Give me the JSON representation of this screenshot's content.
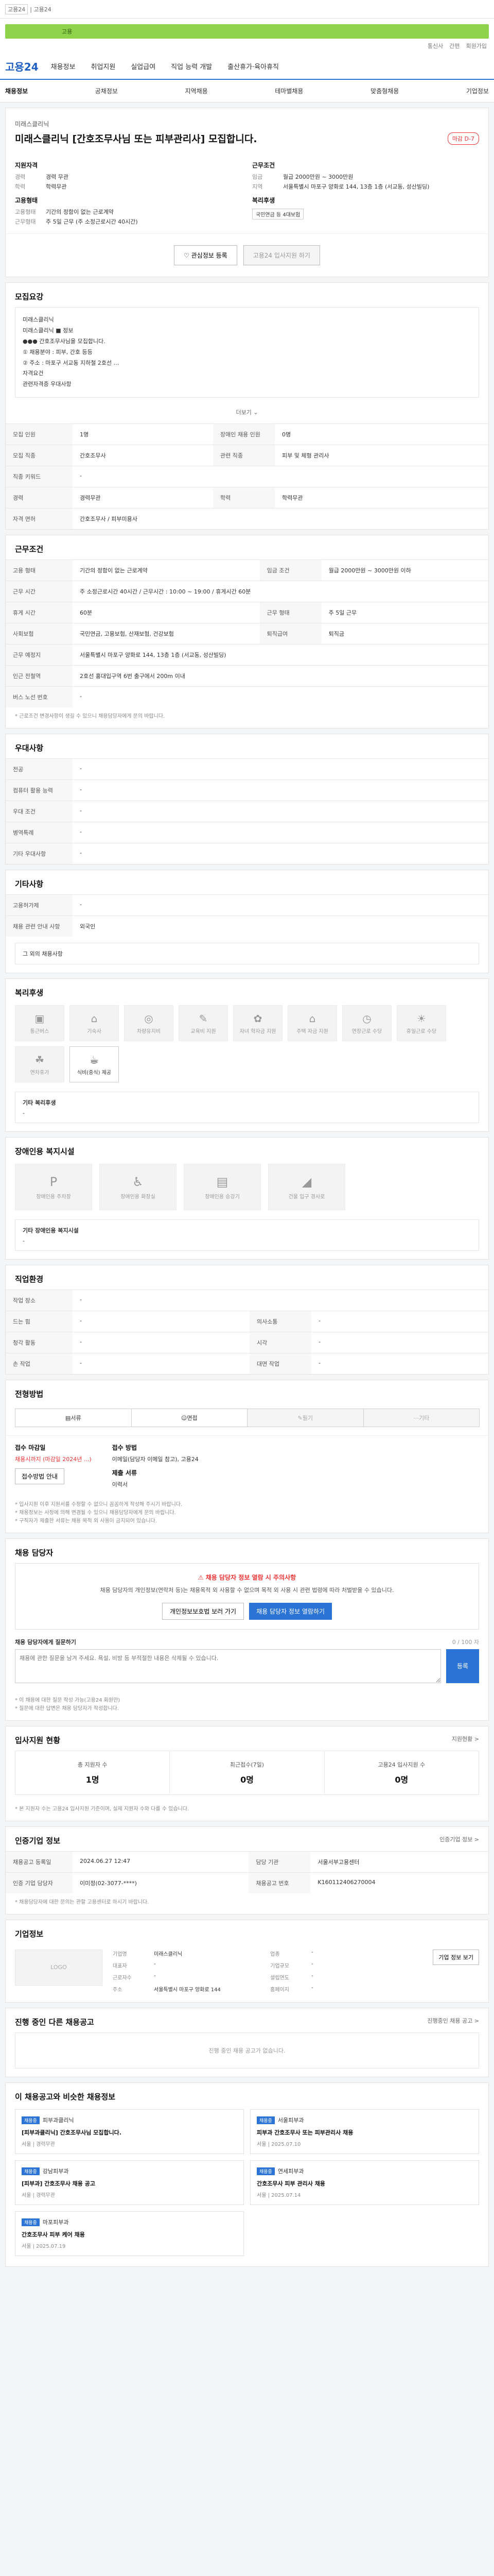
{
  "topbar": {
    "badge": "고용24",
    "text": "| 고용24"
  },
  "banner": {
    "text": "고용",
    "links": [
      "통신사",
      "간편",
      "회원가입"
    ]
  },
  "nav": {
    "logo": "고용24",
    "items": [
      "채용정보",
      "취업지원",
      "실업급여",
      "직업 능력 개발",
      "출산휴가·육아휴직"
    ]
  },
  "subnav": {
    "items": [
      "채용정보",
      "공채정보",
      "지역채용",
      "테마별채용",
      "맞춤형채용",
      "기업정보"
    ]
  },
  "company": {
    "name": "미래스클리닉",
    "title": "미래스클리닉 [간호조무사님 또는 피부관리사] 모집합니다.",
    "tag": "마감 D-7",
    "left_title": "지원자격",
    "left": [
      {
        "k": "경력",
        "v": "경력 무관"
      },
      {
        "k": "학력",
        "v": "학력무관"
      }
    ],
    "left_title2": "고용형태",
    "left2": [
      {
        "k": "고용형태",
        "v": "기간의 정함이 없는 근로계약"
      },
      {
        "k": "근무형태",
        "v": "주 5일 근무 (주 소정근로시간 40시간)"
      }
    ],
    "right_title": "근무조건",
    "right": [
      {
        "k": "임금",
        "v": "월급 2000만원 ~ 3000만원"
      },
      {
        "k": "지역",
        "v": "서울특별시 마포구 양화로 144, 13층 1층 (서교동, 성산빌딩)"
      }
    ],
    "right_title2": "복리후생",
    "right2_chip": "국민연금 등 4대보험"
  },
  "actions": {
    "scrap": "관심정보 등록",
    "apply": "고용24 입사지원 하기"
  },
  "recruit": {
    "title": "모집요강",
    "detail_lines": [
      "미래스클리닉",
      "미래스클리닉 ■ 정보",
      "●●● 간호조무사님을 모집합니다.",
      "① 채용분야 : 피부, 간호 등등",
      "② 주소 : 마포구 서교동 지하철 2호선 ...",
      "자격요건",
      "관련자격증 우대사항"
    ],
    "more": "더보기",
    "rows": [
      {
        "k": "모집 인원",
        "v": "1명",
        "k2": "장애인 채용 인원",
        "v2": "0명"
      },
      {
        "k": "모집 직종",
        "v": "간호조무사",
        "k2": "관련 직종",
        "v2": "피부 및 체형 관리사"
      },
      {
        "k": "직종 키워드",
        "v": "-",
        "k2": "",
        "v2": ""
      },
      {
        "k": "경력",
        "v": "경력무관",
        "k2": "학력",
        "v2": "학력무관"
      },
      {
        "k": "자격 면허",
        "v": "간호조무사 / 피부미용사",
        "k2": "",
        "v2": ""
      }
    ]
  },
  "conditions": {
    "title": "근무조건",
    "rows": [
      {
        "k": "고용 형태",
        "v": "기간의 정함이 없는 근로계약",
        "k2": "임금 조건",
        "v2": "월급 2000만원 ~ 3000만원 이하"
      },
      {
        "k": "근무 시간",
        "v": "주 소정근로시간 40시간 / 근무시간 : 10:00 ~ 19:00 / 휴게시간 60분",
        "k2": "",
        "v2": ""
      },
      {
        "k": "휴게 시간",
        "v": "60분",
        "k2": "근무 형태",
        "v2": "주 5일 근무"
      },
      {
        "k": "사회보험",
        "v": "국민연금, 고용보험, 산재보험, 건강보험",
        "k2": "퇴직급여",
        "v2": "퇴직금"
      },
      {
        "k": "근무 예정지",
        "v": "서울특별시 마포구 양화로 144, 13층 1층 (서교동, 성산빌딩)",
        "k2": "",
        "v2": ""
      },
      {
        "k": "인근 전철역",
        "v": "2호선 홍대입구역 6번 출구에서 200m 이내",
        "k2": "",
        "v2": ""
      },
      {
        "k": "버스 노선 번호",
        "v": "-",
        "k2": "",
        "v2": ""
      }
    ],
    "note": "* 근로조건 변경사항이 생길 수 있으니 채용담당자에게 문의 바랍니다."
  },
  "preferences": {
    "title": "우대사항",
    "rows": [
      {
        "k": "전공",
        "v": "-"
      },
      {
        "k": "컴퓨터 활용 능력",
        "v": "-"
      },
      {
        "k": "우대 조건",
        "v": "-"
      },
      {
        "k": "병역특례",
        "v": "-"
      },
      {
        "k": "기타 우대사항",
        "v": "-"
      }
    ]
  },
  "other": {
    "title": "기타사항",
    "rows": [
      {
        "k": "고용허가제",
        "v": "-"
      },
      {
        "k": "채용 관련 안내 사항",
        "v": "외국인"
      }
    ],
    "sub": "그 외의 채용사항"
  },
  "welfare": {
    "title": "복리후생",
    "items": [
      {
        "label": "통근버스",
        "glyph": "▣",
        "on": false
      },
      {
        "label": "기숙사",
        "glyph": "⌂",
        "on": false
      },
      {
        "label": "차량유지비",
        "glyph": "◎",
        "on": false
      },
      {
        "label": "교육비 지원",
        "glyph": "✎",
        "on": false
      },
      {
        "label": "자녀 학자금 지원",
        "glyph": "✿",
        "on": false
      },
      {
        "label": "주택 자금 지원",
        "glyph": "⌂",
        "on": false
      },
      {
        "label": "연장근로 수당",
        "glyph": "◷",
        "on": false
      },
      {
        "label": "휴일근로 수당",
        "glyph": "☀",
        "on": false
      },
      {
        "label": "연차휴가",
        "glyph": "☘",
        "on": false
      },
      {
        "label": "식비(중식) 제공",
        "glyph": "☕",
        "on": true
      }
    ],
    "sub_title": "기타 복리후생",
    "sub_value": "-"
  },
  "access": {
    "title": "장애인용 복지시설",
    "items": [
      {
        "label": "장애인용 주차장",
        "glyph": "P"
      },
      {
        "label": "장애인용 화장실",
        "glyph": "♿"
      },
      {
        "label": "장애인용 승강기",
        "glyph": "▤"
      },
      {
        "label": "건물 입구 경사로",
        "glyph": "◢"
      }
    ],
    "sub_title": "기타 장애인용 복지시설",
    "sub_value": "-"
  },
  "career": {
    "title": "직업환경",
    "rows": [
      {
        "k": "작업 장소",
        "v": "-",
        "k2": "",
        "v2": ""
      },
      {
        "k": "드는 힘",
        "v": "-",
        "k2": "의사소통",
        "v2": "-"
      },
      {
        "k": "청각 활동",
        "v": "-",
        "k2": "시각",
        "v2": "-"
      },
      {
        "k": "손 작업",
        "v": "-",
        "k2": "대면 작업",
        "v2": "-"
      }
    ]
  },
  "process": {
    "title": "전형방법",
    "steps": [
      {
        "label": "서류",
        "on": true
      },
      {
        "label": "면접",
        "on": true
      },
      {
        "label": "필기",
        "on": false
      },
      {
        "label": "기타",
        "on": false
      }
    ],
    "apply_title": "접수 마감일",
    "apply_value": "채용시까지 (마감일 2024년 ...)",
    "apply_link": "접수방법",
    "method_title": "접수 방법",
    "method_value": "이메일(담당자 이메일 참고), 고용24",
    "doc_title": "제출 서류",
    "doc_value": "이력서",
    "apply_btn": "접수방법 안내",
    "notes": [
      "* 입사지원 이후 지원서를 수정할 수 없으니 꼼꼼하게 작성해 주시기 바랍니다.",
      "* 채용정보는 사정에 의해 변경될 수 있으니 채용담당자에게 문의 바랍니다.",
      "* 구직자가 제출한 서류는 채용 목적 외 사용이 금지되어 있습니다."
    ]
  },
  "inquiry": {
    "title": "채용 담당자",
    "warn": "채용 담당자 정보 열람 시 주의사항",
    "text": "채용 담당자의 개인정보(연락처 등)는 채용목적 외 사용할 수 없으며 목적 외 사용 시 관련 법령에 따라 처벌받을 수 있습니다.",
    "btn1": "개인정보보호법 보러 가기",
    "btn2": "채용 담당자 정보 열람하기",
    "qa_title": "채용 담당자에게 질문하기",
    "qa_counter": "0 / 100 자",
    "qa_placeholder": "채용에 관한 질문을 남겨 주세요. 욕설, 비방 등 부적절한 내용은 삭제될 수 있습니다.",
    "qa_btn": "등록",
    "notes": [
      "* 이 채용에 대한 질문 작성 가능(고용24 회원만)",
      "* 질문에 대한 답변은 채용 담당자가 작성합니다."
    ]
  },
  "stats": {
    "title": "입사지원 현황",
    "more": "지원현황 >",
    "items": [
      {
        "label": "총 지원자 수",
        "value": "1명"
      },
      {
        "label": "최근접수(7일)",
        "value": "0명"
      },
      {
        "label": "고용24 입사지원 수",
        "value": "0명"
      }
    ],
    "note": "* 본 지원자 수는 고용24 입사지원 기준이며, 실제 지원자 수와 다를 수 있습니다."
  },
  "manager": {
    "title": "인증기업 정보",
    "more": "인증기업 정보 >",
    "rows": [
      {
        "k": "채용공고 등록일",
        "v": "2024.06.27 12:47",
        "k2": "담당 기관",
        "v2": "서울서부고용센터"
      },
      {
        "k": "인증 기업 담당자",
        "v": "이미정(02-3077-****)",
        "k2": "채용공고 번호",
        "v2": "K160112406270004"
      }
    ],
    "note": "* 채용담당자에 대한 문의는 관할 고용센터로 하시기 바랍니다."
  },
  "cinfo": {
    "title": "기업정보",
    "logo": "LOGO",
    "rows": [
      {
        "k": "기업명",
        "v": "미래스클리닉",
        "k2": "업종",
        "v2": "-"
      },
      {
        "k": "대표자",
        "v": "-",
        "k2": "기업규모",
        "v2": "-"
      },
      {
        "k": "근로자수",
        "v": "-",
        "k2": "설립연도",
        "v2": "-"
      },
      {
        "k": "주소",
        "v": "서울특별시 마포구 양화로 144",
        "k2": "홈페이지",
        "v2": "-"
      }
    ],
    "btn": "기업 정보 보기"
  },
  "related": {
    "title": "진행 중인 다른 채용공고",
    "more": "진행중인 채용 공고 >",
    "empty": "진행 중인 채용 공고가 없습니다."
  },
  "recs": {
    "title": "이 채용공고와 비슷한 채용정보",
    "items": [
      {
        "lab": "채용중",
        "org": "피부과클리닉",
        "title": "[피부과클리닉] 간호조무사님 모집합니다.",
        "meta": "서울 | 경력무관"
      },
      {
        "lab": "채용중",
        "org": "서울피부과",
        "title": "피부과 간호조무사 또는 피부관리사 채용",
        "meta": "서울 | 2025.07.10"
      },
      {
        "lab": "채용중",
        "org": "강남피부과",
        "title": "[피부과] 간호조무사 채용 공고",
        "meta": "서울 | 경력무관"
      },
      {
        "lab": "채용중",
        "org": "연세피부과",
        "title": "간호조무사 피부 관리사 채용",
        "meta": "서울 | 2025.07.14"
      },
      {
        "lab": "채용중",
        "org": "마포피부과",
        "title": "간호조무사 피부 케어 채용",
        "meta": "서울 | 2025.07.19"
      }
    ]
  }
}
